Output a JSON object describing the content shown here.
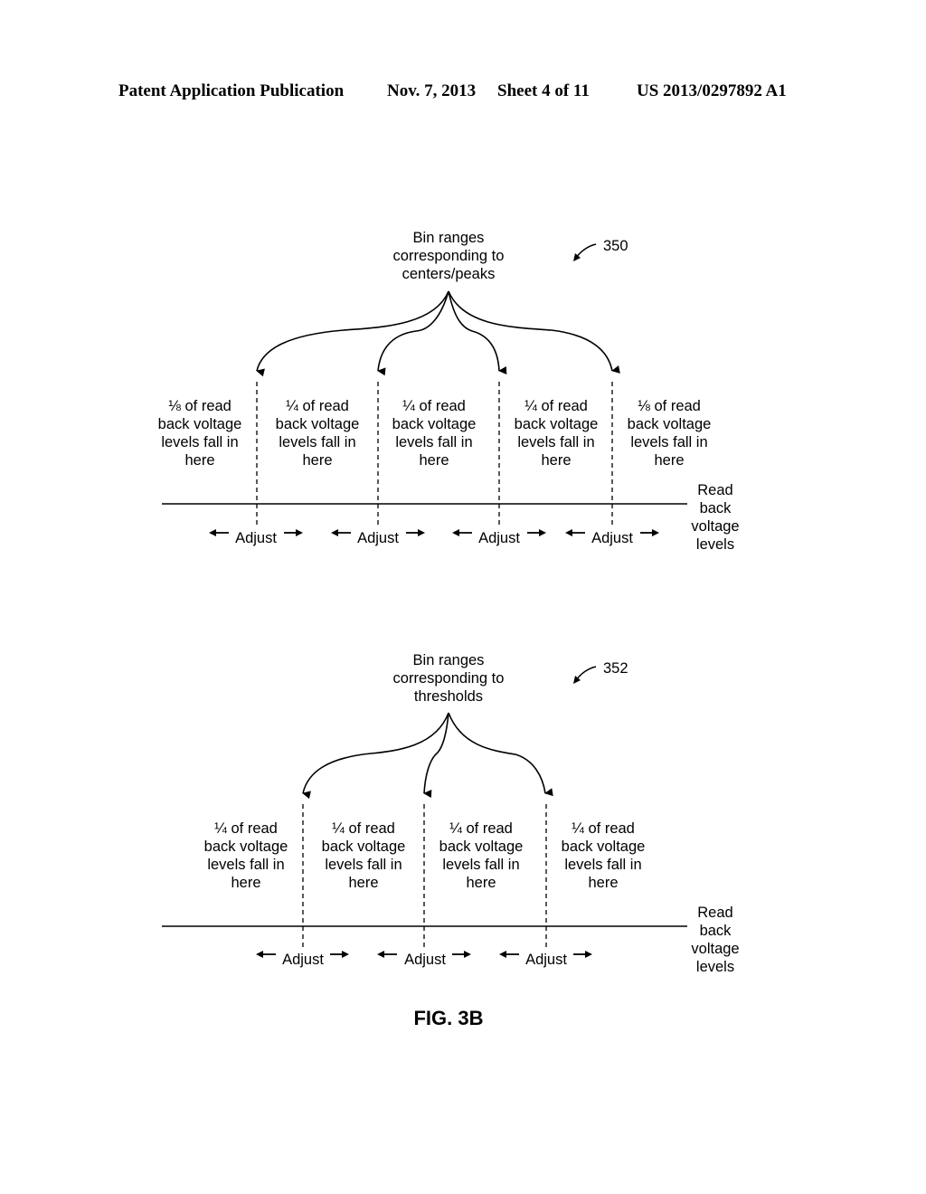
{
  "header": {
    "publication": "Patent Application Publication",
    "date": "Nov. 7, 2013",
    "sheet": "Sheet 4 of 11",
    "number": "US 2013/0297892 A1"
  },
  "diagrams": [
    {
      "ref": "350",
      "title": "Bin ranges\ncorresponding to\ncenters/peaks",
      "bins": [
        "⅛ of read\nback voltage\nlevels fall in\nhere",
        "¼ of read\nback voltage\nlevels fall in\nhere",
        "¼ of read\nback voltage\nlevels fall in\nhere",
        "¼ of read\nback voltage\nlevels fall in\nhere",
        "⅛ of read\nback voltage\nlevels fall in\nhere"
      ],
      "adjust_labels": [
        "Adjust",
        "Adjust",
        "Adjust",
        "Adjust"
      ],
      "axis_label": "Read\nback\nvoltage\nlevels"
    },
    {
      "ref": "352",
      "title": "Bin ranges\ncorresponding to\nthresholds",
      "bins": [
        "¼ of read\nback voltage\nlevels fall in\nhere",
        "¼ of read\nback voltage\nlevels fall in\nhere",
        "¼ of read\nback voltage\nlevels fall in\nhere",
        "¼ of read\nback voltage\nlevels fall in\nhere"
      ],
      "adjust_labels": [
        "Adjust",
        "Adjust",
        "Adjust"
      ],
      "axis_label": "Read\nback\nvoltage\nlevels"
    }
  ],
  "figure_label": "FIG. 3B"
}
